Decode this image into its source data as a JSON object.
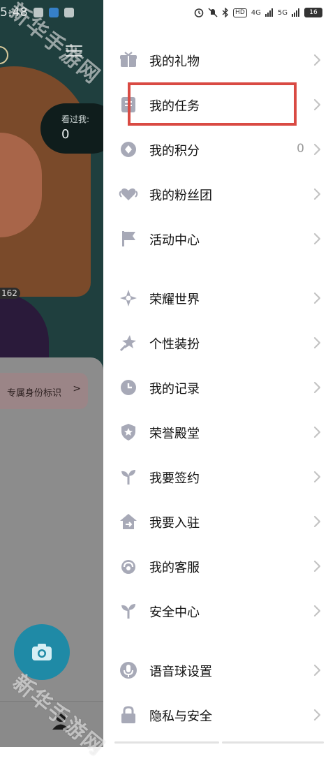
{
  "status_bar": {
    "time": "5:48",
    "signal_4g": "4G",
    "signal_5g": "5G",
    "hd_label": "HD",
    "battery": "16"
  },
  "background_page": {
    "viewed_label": "看过我:",
    "viewed_count": "0",
    "side_count": "162",
    "identity_chip": "专属身份标识",
    "identity_chevron": ">"
  },
  "menu": {
    "items": [
      {
        "label": "我的礼物",
        "icon": "gift-icon",
        "value": ""
      },
      {
        "label": "我的任务",
        "icon": "task-icon",
        "value": ""
      },
      {
        "label": "我的积分",
        "icon": "points-icon",
        "value": "0"
      },
      {
        "label": "我的粉丝团",
        "icon": "fan-club-icon",
        "value": ""
      },
      {
        "label": "活动中心",
        "icon": "flag-icon",
        "value": ""
      },
      {
        "label": "荣耀世界",
        "icon": "glory-world-icon",
        "value": ""
      },
      {
        "label": "个性装扮",
        "icon": "star-wand-icon",
        "value": ""
      },
      {
        "label": "我的记录",
        "icon": "clock-icon",
        "value": ""
      },
      {
        "label": "荣誉殿堂",
        "icon": "shield-star-icon",
        "value": ""
      },
      {
        "label": "我要签约",
        "icon": "sprout-icon",
        "value": ""
      },
      {
        "label": "我要入驻",
        "icon": "home-join-icon",
        "value": ""
      },
      {
        "label": "我的客服",
        "icon": "headset-icon",
        "value": ""
      },
      {
        "label": "安全中心",
        "icon": "sprout-icon",
        "value": ""
      },
      {
        "label": "语音球设置",
        "icon": "microphone-icon",
        "value": ""
      },
      {
        "label": "隐私与安全",
        "icon": "lock-icon",
        "value": ""
      }
    ]
  },
  "watermark": {
    "text": "新华手游网"
  },
  "colors": {
    "icon": "#a7a9b7",
    "highlight": "#d94a43",
    "chevron": "#c4c4c4"
  }
}
